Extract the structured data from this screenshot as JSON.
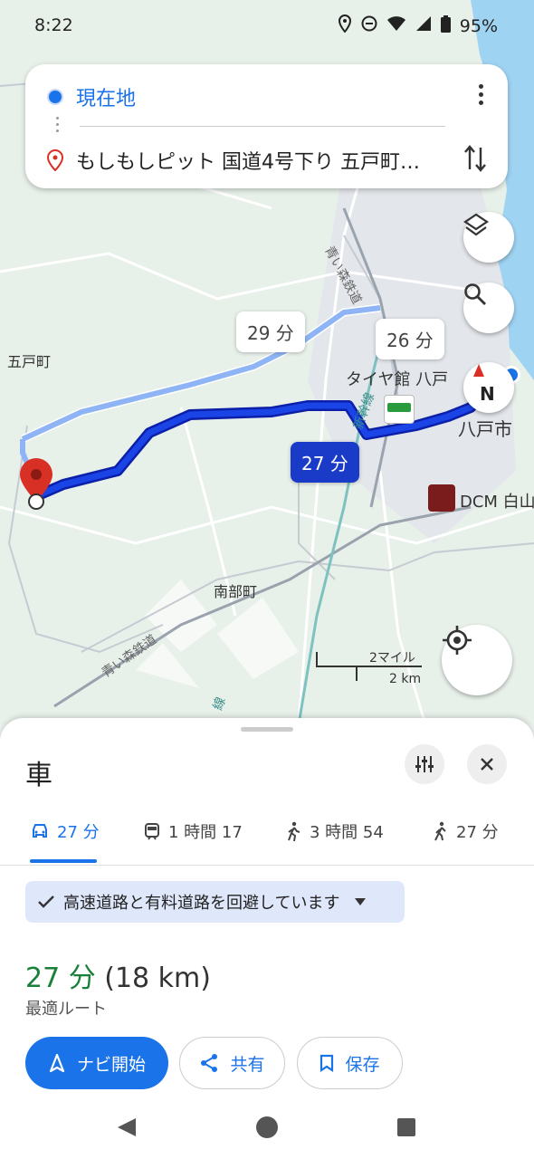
{
  "status": {
    "time": "8:22",
    "battery": "95%"
  },
  "search": {
    "origin": "現在地",
    "destination": "もしもしピット 国道4号下り 五戸町…"
  },
  "map": {
    "alt_route_1_time": "29 分",
    "alt_route_2_time": "26 分",
    "selected_route_time": "27 分",
    "labels": {
      "gonohe": "五戸町",
      "nanbu": "南部町",
      "hachinohe": "八戸市",
      "tire": "タイヤ館 八戸",
      "dcm": "DCM 白山",
      "railway1": "青い森鉄道",
      "railway2": "青い森鉄道",
      "shinkansen": "新幹線",
      "line": "線",
      "compass": "N"
    },
    "scale": {
      "miles": "2マイル",
      "km": "2 km"
    },
    "colors": {
      "route": "#1a3bc8",
      "alt_route": "#8fb4f5",
      "pin": "#d93025"
    }
  },
  "sheet": {
    "mode_title": "車",
    "tabs": [
      {
        "icon": "car-icon",
        "label": "27 分"
      },
      {
        "icon": "train-icon",
        "label": "1 時間 17"
      },
      {
        "icon": "walk-icon",
        "label": "3 時間 54"
      },
      {
        "icon": "ride-icon",
        "label": "27 分"
      }
    ],
    "avoid_label": "高速道路と有料道路を回避しています",
    "duration": "27 分",
    "distance": "(18 km)",
    "route_desc": "最適ルート",
    "buttons": {
      "navigate": "ナビ開始",
      "share": "共有",
      "save": "保存"
    }
  }
}
